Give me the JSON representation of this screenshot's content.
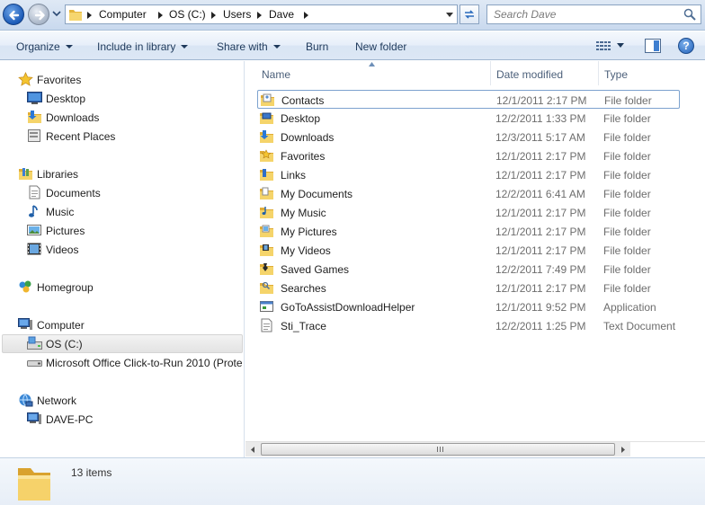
{
  "address_bar": {
    "breadcrumbs": [
      "Computer",
      "OS (C:)",
      "Users",
      "Dave"
    ]
  },
  "search": {
    "placeholder": "Search Dave"
  },
  "toolbar": {
    "organize": "Organize",
    "include_in_library": "Include in library",
    "share_with": "Share with",
    "burn": "Burn",
    "new_folder": "New folder"
  },
  "nav": {
    "favorites": {
      "label": "Favorites",
      "items": [
        "Desktop",
        "Downloads",
        "Recent Places"
      ]
    },
    "libraries": {
      "label": "Libraries",
      "items": [
        "Documents",
        "Music",
        "Pictures",
        "Videos"
      ]
    },
    "homegroup": "Homegroup",
    "computer": {
      "label": "Computer",
      "items": [
        "OS (C:)",
        "Microsoft Office Click-to-Run 2010 (Prote"
      ]
    },
    "network": {
      "label": "Network",
      "items": [
        "DAVE-PC"
      ]
    }
  },
  "columns": {
    "name": "Name",
    "date_modified": "Date modified",
    "type": "Type"
  },
  "files": [
    {
      "name": "Contacts",
      "date": "12/1/2011 2:17 PM",
      "type": "File folder",
      "icon": "contacts-folder-icon"
    },
    {
      "name": "Desktop",
      "date": "12/2/2011 1:33 PM",
      "type": "File folder",
      "icon": "desktop-folder-icon"
    },
    {
      "name": "Downloads",
      "date": "12/3/2011 5:17 AM",
      "type": "File folder",
      "icon": "downloads-folder-icon"
    },
    {
      "name": "Favorites",
      "date": "12/1/2011 2:17 PM",
      "type": "File folder",
      "icon": "favorites-folder-icon"
    },
    {
      "name": "Links",
      "date": "12/1/2011 2:17 PM",
      "type": "File folder",
      "icon": "links-folder-icon"
    },
    {
      "name": "My Documents",
      "date": "12/2/2011 6:41 AM",
      "type": "File folder",
      "icon": "documents-folder-icon"
    },
    {
      "name": "My Music",
      "date": "12/1/2011 2:17 PM",
      "type": "File folder",
      "icon": "music-folder-icon"
    },
    {
      "name": "My Pictures",
      "date": "12/1/2011 2:17 PM",
      "type": "File folder",
      "icon": "pictures-folder-icon"
    },
    {
      "name": "My Videos",
      "date": "12/1/2011 2:17 PM",
      "type": "File folder",
      "icon": "videos-folder-icon"
    },
    {
      "name": "Saved Games",
      "date": "12/2/2011 7:49 PM",
      "type": "File folder",
      "icon": "saved-games-folder-icon"
    },
    {
      "name": "Searches",
      "date": "12/1/2011 2:17 PM",
      "type": "File folder",
      "icon": "searches-folder-icon"
    },
    {
      "name": "GoToAssistDownloadHelper",
      "date": "12/1/2011 9:52 PM",
      "type": "Application",
      "icon": "application-icon"
    },
    {
      "name": "Sti_Trace",
      "date": "12/2/2011 1:25 PM",
      "type": "Text Document",
      "icon": "text-document-icon"
    }
  ],
  "details": {
    "item_count": "13 items"
  },
  "colors": {
    "toolbar_text": "#1e395b",
    "folder_yellow": "#f1c84b",
    "meta_text": "#6d6d6d",
    "column_header_text": "#4c607a"
  }
}
